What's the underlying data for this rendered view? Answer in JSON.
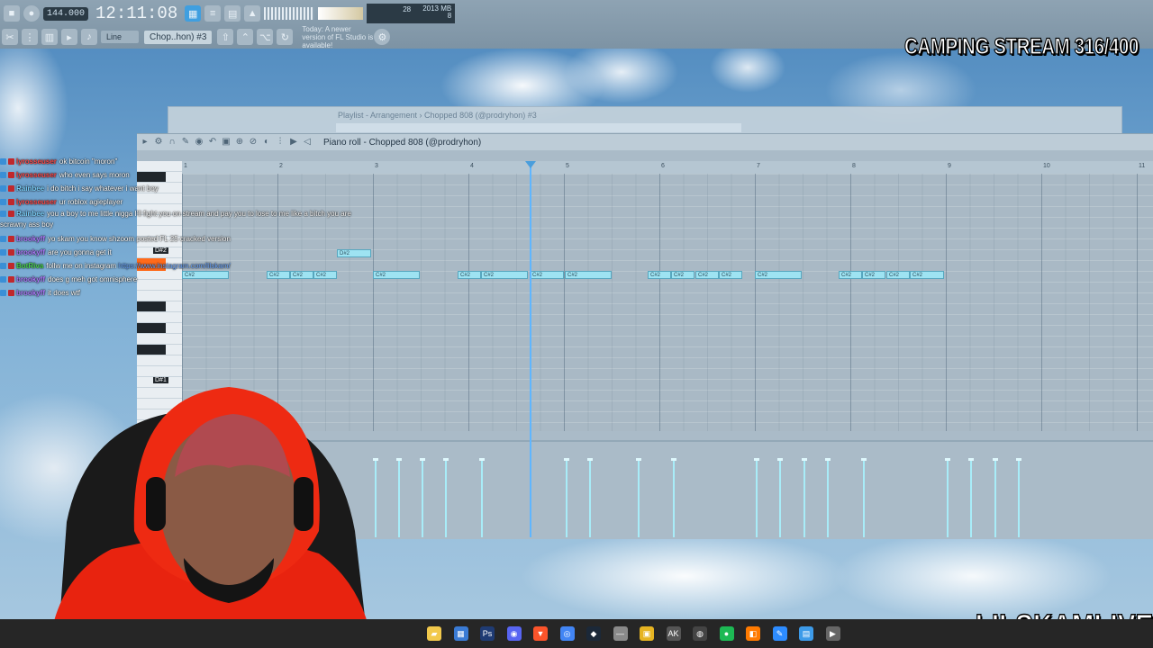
{
  "toolbar": {
    "tempo": "144.000",
    "clock": "12:11:08",
    "cpu_left": "28",
    "cpu_mem": "2013 MB",
    "cpu_poly": "8",
    "snap": "Line",
    "pattern": "Chop..hon) #3",
    "hint": "Today: A newer version of FL Studio is available!"
  },
  "overlay": {
    "title": "CAMPING STREAM 316/400",
    "brand": "LILSKAMLIVE"
  },
  "playlist": {
    "title": "Playlist - Arrangement › Chopped 808 (@prodryhon) #3"
  },
  "piano_roll": {
    "title": "Piano roll - Chopped 808 (@prodryhon)",
    "bars": [
      "1",
      "2",
      "3",
      "4",
      "5",
      "6",
      "7",
      "8",
      "9",
      "10",
      "11"
    ],
    "key_labels": [
      "D#2",
      "D#1"
    ],
    "note_label": "C#2",
    "high_note_label": "D#2"
  },
  "chat": [
    {
      "user": "lyrosseuser",
      "color": "#ff4a4a",
      "text": "ok bitcoin \"moron\""
    },
    {
      "user": "lyrosseuser",
      "color": "#ff4a4a",
      "text": "who even says moron"
    },
    {
      "user": "Rainbee",
      "color": "#7fd3ff",
      "text": "i do bitch i say whatever i want boy"
    },
    {
      "user": "lyrosseuser",
      "color": "#ff4a4a",
      "text": "ur roblox agieplayer"
    },
    {
      "user": "Rainbee",
      "color": "#7fd3ff",
      "text": "you a boy to me little nigga I'll fight you on stream and pay you to lose to me like a bitch you are scrawny ass boy"
    },
    {
      "user": "brookyff",
      "color": "#b07cff",
      "text": "yo skam you know shzoom posted FL 25 cracked version"
    },
    {
      "user": "brookyff",
      "color": "#b07cff",
      "text": "are you gonna get it"
    },
    {
      "user": "BotRiva",
      "color": "#4bd34b",
      "text": "follw me on instagram",
      "link": "https://www.instagram.com/lilskam/"
    },
    {
      "user": "brookyff",
      "color": "#b07cff",
      "text": "does g meh got omnisphere"
    },
    {
      "user": "brookyff",
      "color": "#b07cff",
      "text": "it does wtf"
    }
  ],
  "taskbar": {
    "icons": [
      "folder-icon",
      "store-icon",
      "photoshop-icon",
      "discord-icon",
      "brave-icon",
      "chrome-icon",
      "steam-icon",
      "dash-icon",
      "box-icon",
      "ak-icon",
      "obs-icon",
      "spotify-icon",
      "fl-studio-icon",
      "edit-icon",
      "files-icon",
      "media-icon"
    ]
  }
}
